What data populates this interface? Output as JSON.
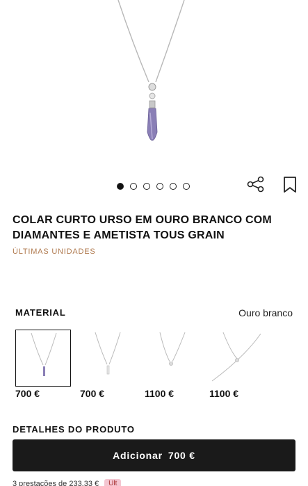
{
  "product": {
    "title": "COLAR CURTO URSO EM OURO BRANCO COM DIAMANTES E AMETISTA TOUS GRAIN",
    "badge": "ÚLTIMAS UNIDADES"
  },
  "gallery": {
    "dots_total": 6,
    "active_index": 0
  },
  "icons": {
    "share": "share-icon",
    "bookmark": "bookmark-icon"
  },
  "material": {
    "label": "MATERIAL",
    "value": "Ouro branco"
  },
  "variants": [
    {
      "price": "700 €",
      "selected": true
    },
    {
      "price": "700 €",
      "selected": false
    },
    {
      "price": "1100 €",
      "selected": false
    },
    {
      "price": "1100 €",
      "selected": false
    }
  ],
  "details": {
    "label": "DETALHES DO PRODUTO"
  },
  "cta": {
    "label": "Adicionar",
    "price": "700 €"
  },
  "installments": {
    "text": "3 prestações de 233,33 €",
    "pill": "Ult"
  },
  "colors": {
    "accent": "#b07a4f",
    "cta_bg": "#1a1a1a",
    "stone": "#8a7fb6"
  }
}
